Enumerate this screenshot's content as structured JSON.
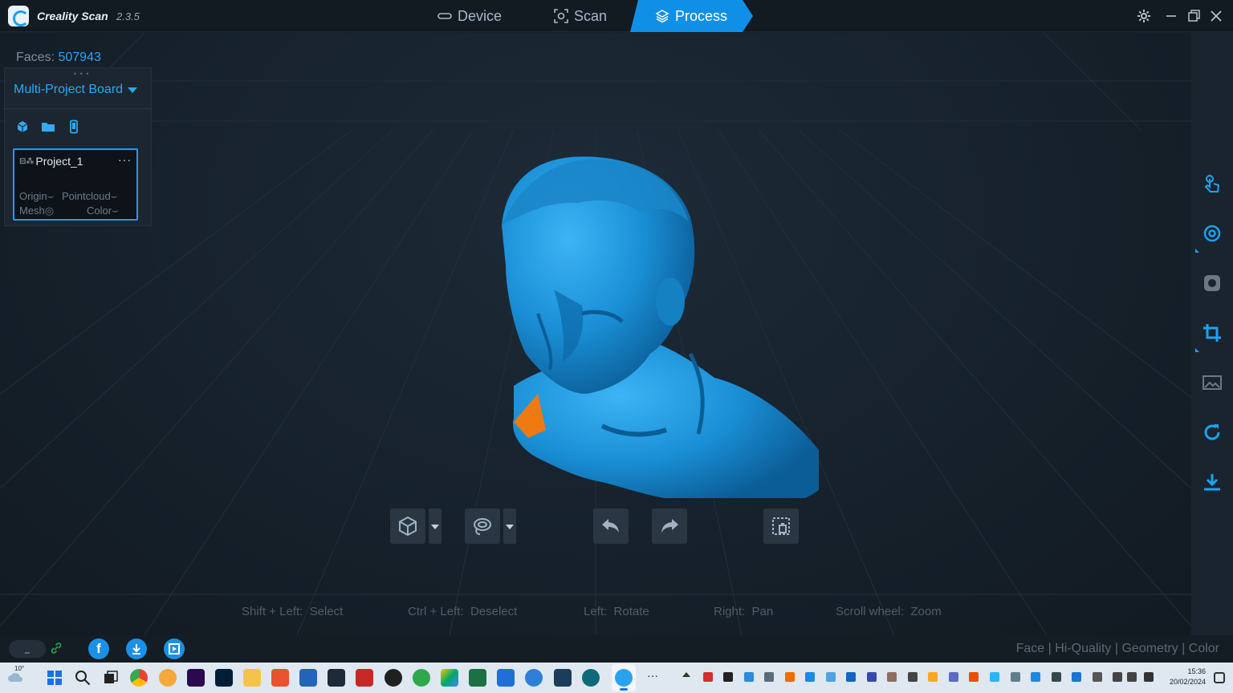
{
  "titlebar": {
    "app_name": "Creality Scan",
    "version": "2.3.5",
    "tabs": [
      {
        "label": "Device",
        "icon": "device-icon"
      },
      {
        "label": "Scan",
        "icon": "scan-icon"
      },
      {
        "label": "Process",
        "icon": "layers-icon",
        "active": true
      }
    ],
    "accent_color": "#0f8fe6"
  },
  "viewport": {
    "faces_label": "Faces:",
    "faces_value": "507943",
    "model_color": "#1a8fd6",
    "selection_color": "#f07a12"
  },
  "project_board": {
    "title": "Multi-Project Board",
    "icons": [
      "cube-icon",
      "folder-icon",
      "phone-icon"
    ],
    "project": {
      "name": "Project_1",
      "attributes": [
        "Origin",
        "Pointcloud",
        "Mesh",
        "Color"
      ]
    }
  },
  "right_tools": [
    "touch-icon",
    "fuse-icon",
    "texture-icon",
    "crop-icon",
    "image-icon",
    "refresh-icon",
    "download-icon"
  ],
  "bottom_tools": [
    "view-cube-icon",
    "lasso-select-icon",
    "undo-icon",
    "redo-icon",
    "delete-selection-icon"
  ],
  "hints": [
    {
      "key": "Shift + Left:",
      "action": "Select"
    },
    {
      "key": "Ctrl + Left:",
      "action": "Deselect"
    },
    {
      "key": "Left:",
      "action": "Rotate"
    },
    {
      "key": "Right:",
      "action": "Pan"
    },
    {
      "key": "Scroll wheel:",
      "action": "Zoom"
    }
  ],
  "statusbar": {
    "render_modes": "Face | Hi-Quality | Geometry | Color"
  },
  "taskbar": {
    "temperature": "10°",
    "time": "15:36",
    "date": "20/02/2024"
  }
}
